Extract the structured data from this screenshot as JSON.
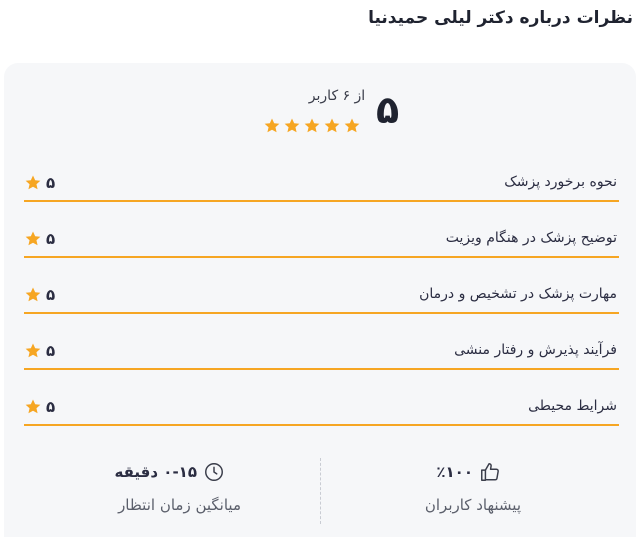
{
  "heading": "نظرات درباره دکتر لیلی حمیدنیا",
  "summary": {
    "score": "۵",
    "count_text": "از ۶ کاربر",
    "stars": 5
  },
  "ratings": [
    {
      "label": "نحوه برخورد پزشک",
      "score": "۵"
    },
    {
      "label": "توضیح پزشک در هنگام ویزیت",
      "score": "۵"
    },
    {
      "label": "مهارت پزشک در تشخیص و درمان",
      "score": "۵"
    },
    {
      "label": "فرآیند پذیرش و رفتار منشی",
      "score": "۵"
    },
    {
      "label": "شرایط محیطی",
      "score": "۵"
    }
  ],
  "stats": {
    "recommend": {
      "value": "٪۱۰۰",
      "label": "پیشنهاد کاربران",
      "icon": "thumbs-up-icon"
    },
    "wait": {
      "value": "۰-۱۵ دقیقه",
      "label": "میانگین زمان انتظار",
      "icon": "clock-icon"
    }
  },
  "colors": {
    "star": "#f6a623",
    "card_bg": "#f6f7f9",
    "row_line": "#f6a623"
  }
}
